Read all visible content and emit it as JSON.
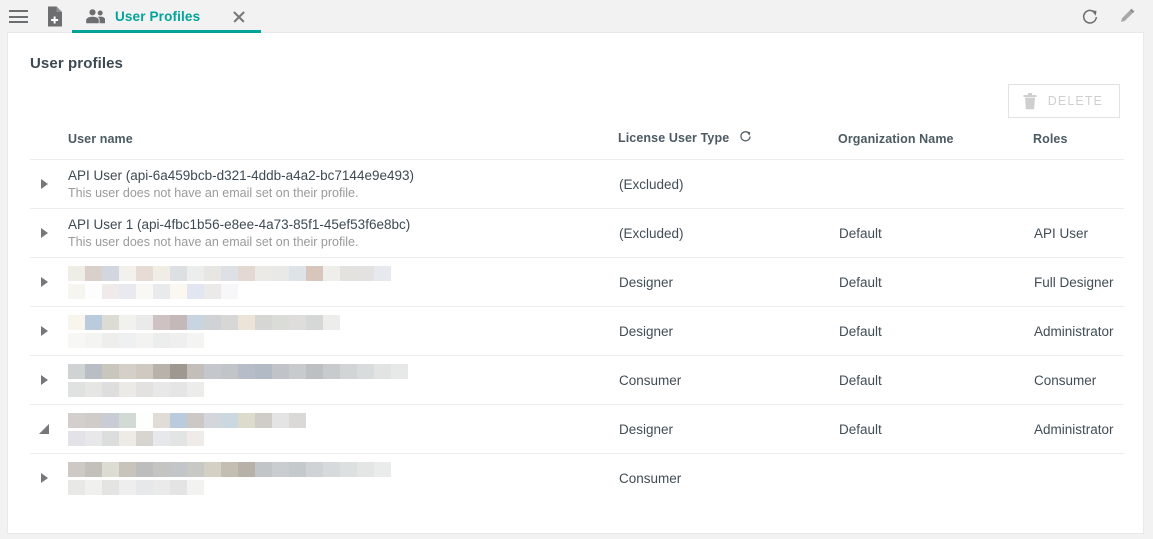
{
  "topbar": {
    "menu_icon": "hamburger-menu-icon",
    "new_doc_icon": "new-document-icon",
    "refresh_icon": "refresh-icon",
    "edit_icon": "pencil-edit-icon",
    "tab": {
      "label": "User Profiles",
      "icon": "users-group-icon",
      "close_icon": "close-icon"
    }
  },
  "page": {
    "title": "User profiles"
  },
  "toolbar": {
    "delete_label": "DELETE",
    "delete_icon": "trash-icon",
    "delete_disabled": true
  },
  "table": {
    "headers": {
      "expand": "",
      "user_name": "User name",
      "license_user_type": "License User Type",
      "license_refresh_icon": "refresh-icon",
      "organization_name": "Organization Name",
      "roles": "Roles"
    },
    "rows": [
      {
        "expand_icon": "caret-right-icon",
        "redacted": false,
        "user_name": "API User (api-6a459bcb-d321-4ddb-a4a2-bc7144e9e493)",
        "user_note": "This user does not have an email set on their profile.",
        "license_user_type": "(Excluded)",
        "organization_name": "",
        "roles": ""
      },
      {
        "expand_icon": "caret-right-icon",
        "redacted": false,
        "user_name": "API User 1 (api-4fbc1b56-e8ee-4a73-85f1-45ef53f6e8bc)",
        "user_note": "This user does not have an email set on their profile.",
        "license_user_type": "(Excluded)",
        "organization_name": "Default",
        "roles": "API User"
      },
      {
        "expand_icon": "caret-right-icon",
        "redacted": true,
        "user_name": "",
        "user_note": "",
        "license_user_type": "Designer",
        "organization_name": "Default",
        "roles": "Full Designer"
      },
      {
        "expand_icon": "caret-right-icon",
        "redacted": true,
        "user_name": "",
        "user_note": "",
        "license_user_type": "Designer",
        "organization_name": "Default",
        "roles": "Administrator"
      },
      {
        "expand_icon": "caret-right-icon",
        "redacted": true,
        "user_name": "",
        "user_note": "",
        "license_user_type": "Consumer",
        "organization_name": "Default",
        "roles": "Consumer"
      },
      {
        "expand_icon": "caret-corner-icon",
        "redacted": true,
        "user_name": "",
        "user_note": "",
        "license_user_type": "Designer",
        "organization_name": "Default",
        "roles": "Administrator"
      },
      {
        "expand_icon": "caret-right-icon",
        "redacted": true,
        "user_name": "",
        "user_note": "",
        "license_user_type": "Consumer",
        "organization_name": "",
        "roles": ""
      }
    ],
    "redaction_blocks": [
      {
        "top": [
          "#efeee6",
          "#d9cfcb",
          "#d2d6de",
          "#f3f1ee",
          "#e6dbd5",
          "#f0ece6",
          "#dce0e2",
          "#eceeee",
          "#e8e6e2",
          "#dde1e5",
          "#e4d8d2",
          "#eceae6",
          "#e9e9e7",
          "#dee3e7",
          "#d8c6bd",
          "#eeeeea",
          "#e4e2de",
          "#e3e2e0",
          "#e6eaee"
        ],
        "bottom": [
          "#f7f5f0",
          "#fdfdfd",
          "#f0eaea",
          "#e9eaf0",
          "#faf8f4",
          "#e9eaec",
          "#fbf8f2",
          "#e2e6f0",
          "#eceae8",
          "#f7f7f9"
        ]
      },
      {
        "top": [
          "#f7f5ee",
          "#b9cbdd",
          "#dcdcd4",
          "#f1f1ed",
          "#ebeaea",
          "#cfc2c2",
          "#c4b8b8",
          "#c8d4e0",
          "#cfd3d5",
          "#d7d7d5",
          "#ece4d8",
          "#d6d6d4",
          "#dadcd8",
          "#dfdddb",
          "#d6d8d8",
          "#ededeb"
        ],
        "bottom": [
          "#f7f7f5",
          "#f4f4f2",
          "#eeeeec",
          "#eef0f2",
          "#f3f3f1",
          "#eceeee",
          "#efefef",
          "#f4f4f2"
        ]
      },
      {
        "top": [
          "#cfd3d3",
          "#b9bec4",
          "#c9c6bd",
          "#d4cfc8",
          "#cfc9c2",
          "#b9b2ab",
          "#9e9890",
          "#c3beb9",
          "#c4c8cc",
          "#c2c5c8",
          "#b6bcc8",
          "#b2bac6",
          "#c0c4c8",
          "#c8cbce",
          "#bdc0c2",
          "#c8cbcb",
          "#d2d5d5",
          "#d9dcdc",
          "#e2e4e4",
          "#e7e9e9"
        ],
        "bottom": [
          "#e0e2e2",
          "#e6e6e4",
          "#dedede",
          "#eceae6",
          "#e3e2e0",
          "#e8e8e8",
          "#e5e5e5",
          "#ececea"
        ]
      },
      {
        "top": [
          "#d4cecc",
          "#cfccca",
          "#c9cbd5",
          "#d2dad6",
          "#fdfffd",
          "#e2dcd6",
          "#b9cbdd",
          "#cdc8c6",
          "#d3d7db",
          "#ccd8e0",
          "#dcdccc",
          "#d0cdc8",
          "#e4e4e4",
          "#dbd9d7"
        ],
        "bottom": [
          "#e2e2e8",
          "#e8e8ea",
          "#dcdedd",
          "#eeeae6",
          "#d8d4d0",
          "#e7e8ec",
          "#e3e4e4",
          "#eeebe8"
        ]
      },
      {
        "top": [
          "#cfc9c6",
          "#c3c0bc",
          "#dcdcd2",
          "#c8c4bc",
          "#bdbdbd",
          "#c4c4c2",
          "#c2c6c8",
          "#c8c8c4",
          "#d4d0c4",
          "#c4bdb2",
          "#b8b1aa",
          "#c2c5c8",
          "#cacdcf",
          "#c4c9cc",
          "#d0d3d5",
          "#d7dada",
          "#dde0e0",
          "#e4e6e6",
          "#eaecec"
        ],
        "bottom": [
          "#e8e8e6",
          "#f0f0ee",
          "#e4e4e2",
          "#eeeeee",
          "#e6e8ea",
          "#eaeaea",
          "#e4e4e4",
          "#f2f2f0"
        ]
      }
    ]
  },
  "colors": {
    "accent": "#00a499",
    "page_bg": "#f2f2f2",
    "card_bg": "#ffffff",
    "text": "#404d56",
    "muted": "#9a9a9a",
    "border": "#ededed"
  }
}
